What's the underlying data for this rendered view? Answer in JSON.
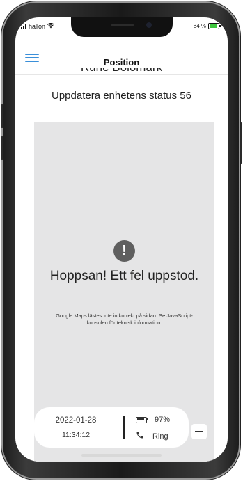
{
  "status_bar": {
    "carrier": "hallon",
    "battery_percent": "84 %"
  },
  "header": {
    "title": "Position"
  },
  "device": {
    "name_partial": "Rune Bolomark",
    "status_line": "Uppdatera enhetens status 56"
  },
  "map": {
    "error_title": "Hoppsan! Ett fel uppstod.",
    "error_message": "Google Maps lästes inte in korrekt på sidan. Se JavaScript-konsolen för teknisk information."
  },
  "info_card": {
    "date": "2022-01-28",
    "time": "11:34:12",
    "battery": "97%",
    "call_label": "Ring"
  },
  "colors": {
    "accent": "#3a8fd9",
    "map_bg": "#e5e5e6",
    "error_icon": "#5f5f5f"
  },
  "icons": [
    "hamburger-menu-icon",
    "wifi-icon",
    "battery-icon",
    "error-exclamation-icon",
    "phone-icon",
    "minus-icon"
  ]
}
